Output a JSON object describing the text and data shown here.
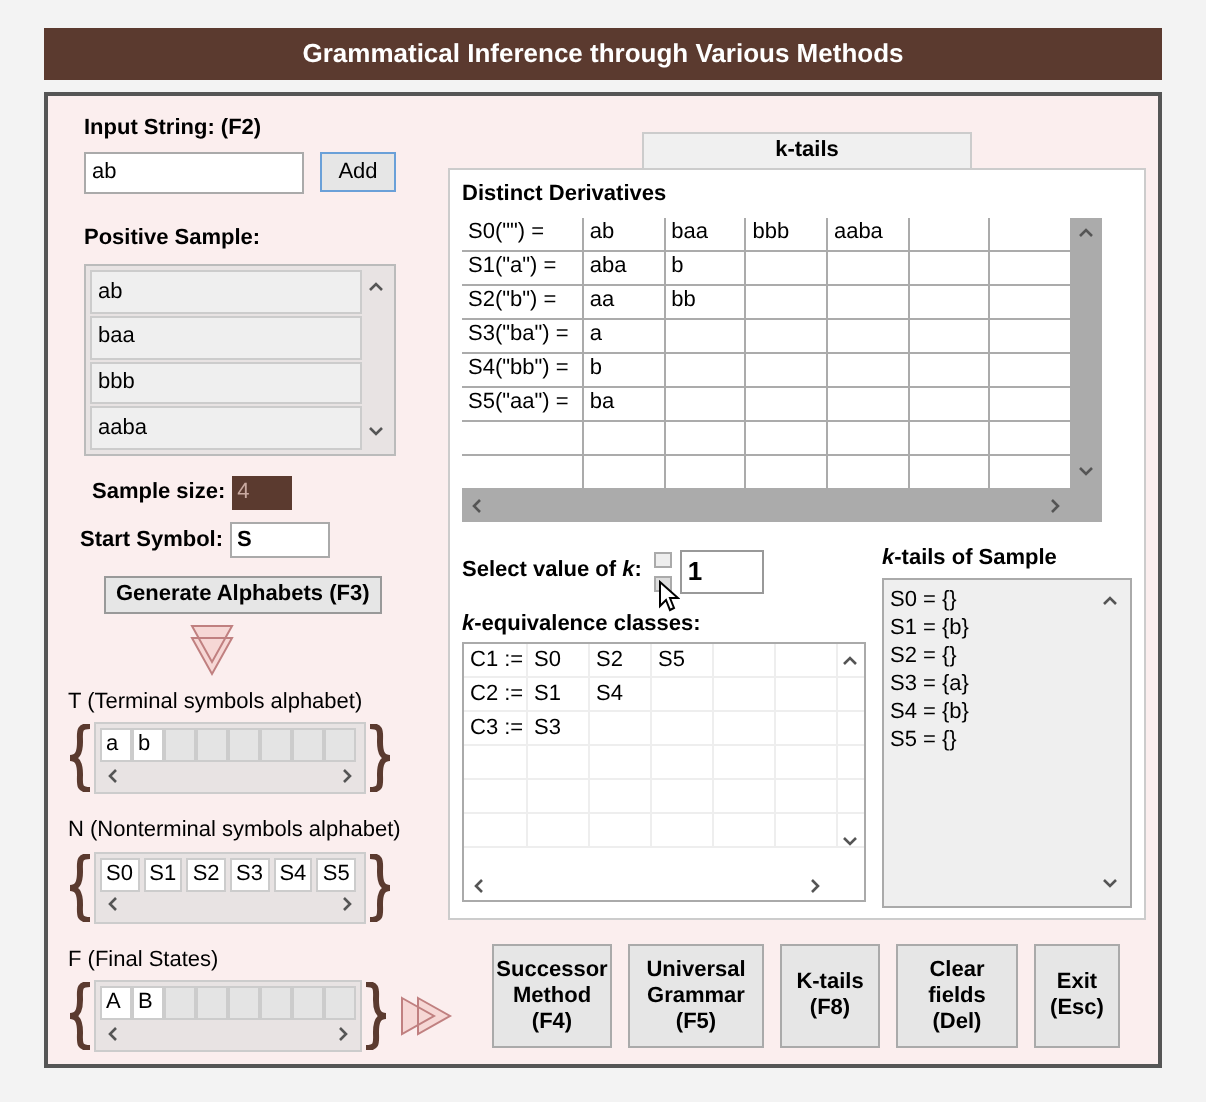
{
  "title": "Grammatical Inference through Various Methods",
  "input_string": {
    "label": "Input String: (F2)",
    "value": "ab"
  },
  "add_button": "Add",
  "positive_sample": {
    "label": "Positive Sample:",
    "items": [
      "ab",
      "baa",
      "bbb",
      "aaba"
    ]
  },
  "sample_size": {
    "label": "Sample size:",
    "value": "4"
  },
  "start_symbol": {
    "label": "Start Symbol:",
    "value": "S"
  },
  "generate_button": "Generate Alphabets (F3)",
  "alphabets": [
    {
      "label": "T (Terminal symbols alphabet)",
      "symbols": [
        "a",
        "b"
      ]
    },
    {
      "label": "N (Nonterminal symbols alphabet)",
      "symbols": [
        "S0",
        "S1",
        "S2",
        "S3",
        "S4",
        "S5"
      ]
    },
    {
      "label": "F (Final States)",
      "symbols": [
        "A",
        "B"
      ]
    }
  ],
  "tabs": [
    {
      "label": "k-tails",
      "selected": true
    }
  ],
  "distinct_derivatives": {
    "label": "Distinct Derivatives",
    "rows": [
      {
        "head": "S0(\"\") =",
        "cells": [
          "ab",
          "baa",
          "bbb",
          "aaba"
        ]
      },
      {
        "head": "S1(\"a\") =",
        "cells": [
          "aba",
          "b"
        ]
      },
      {
        "head": "S2(\"b\") =",
        "cells": [
          "aa",
          "bb"
        ]
      },
      {
        "head": "S3(\"ba\") =",
        "cells": [
          "a"
        ]
      },
      {
        "head": "S4(\"bb\") =",
        "cells": [
          "b"
        ]
      },
      {
        "head": "S5(\"aa\") =",
        "cells": [
          "ba"
        ]
      }
    ]
  },
  "k_select": {
    "label": "Select value of *k*:",
    "value": "1"
  },
  "equivalence_classes": {
    "label": "*k*-equivalence classes:",
    "rows": [
      {
        "head": "C1 :=",
        "cells": [
          "S0",
          "S2",
          "S5"
        ]
      },
      {
        "head": "C2 :=",
        "cells": [
          "S1",
          "S4"
        ]
      },
      {
        "head": "C3 :=",
        "cells": [
          "S3"
        ]
      }
    ]
  },
  "k_tails": {
    "label": "*k*-tails of Sample",
    "items": [
      "S0 = {}",
      "S1 = {b}",
      "S2 = {}",
      "S3 = {a}",
      "S4 = {b}",
      "S5 = {}"
    ]
  },
  "buttons": [
    {
      "lines": [
        "Successor",
        "Method",
        "(F4)"
      ]
    },
    {
      "lines": [
        "Universal",
        "Grammar",
        "(F5)"
      ]
    },
    {
      "lines": [
        "K-tails",
        "(F8)"
      ]
    },
    {
      "lines": [
        "Clear fields",
        "(Del)"
      ]
    },
    {
      "lines": [
        "Exit",
        "(Esc)"
      ]
    }
  ]
}
